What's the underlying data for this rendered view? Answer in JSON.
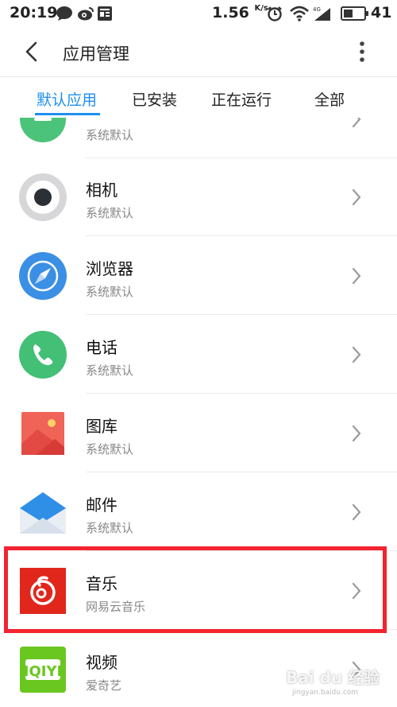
{
  "status_bar": {
    "time": "20:19",
    "speed": "1.56",
    "speed_unit": "K/s",
    "battery": "41"
  },
  "header": {
    "title": "应用管理",
    "back_icon": "chevron-left-icon",
    "more_icon": "more-vertical-icon"
  },
  "tabs": [
    {
      "label": "默认应用",
      "active": true
    },
    {
      "label": "已安装",
      "active": false
    },
    {
      "label": "正在运行",
      "active": false
    },
    {
      "label": "全部",
      "active": false
    }
  ],
  "accent_color": "#1e8ff0",
  "highlight_color": "#f3232f",
  "list": {
    "partial_top_sub": "系统默认",
    "items": [
      {
        "name": "相机",
        "sub": "系统默认",
        "icon": "camera-icon"
      },
      {
        "name": "浏览器",
        "sub": "系统默认",
        "icon": "browser-compass-icon"
      },
      {
        "name": "电话",
        "sub": "系统默认",
        "icon": "phone-icon"
      },
      {
        "name": "图库",
        "sub": "系统默认",
        "icon": "gallery-icon"
      },
      {
        "name": "邮件",
        "sub": "系统默认",
        "icon": "mail-icon"
      },
      {
        "name": "音乐",
        "sub": "网易云音乐",
        "icon": "netease-music-icon"
      },
      {
        "name": "视频",
        "sub": "爱奇艺",
        "icon": "iqiyi-icon"
      }
    ]
  },
  "watermark": {
    "logo": "Bai du 经验",
    "url": "jingyan.baidu.com"
  }
}
